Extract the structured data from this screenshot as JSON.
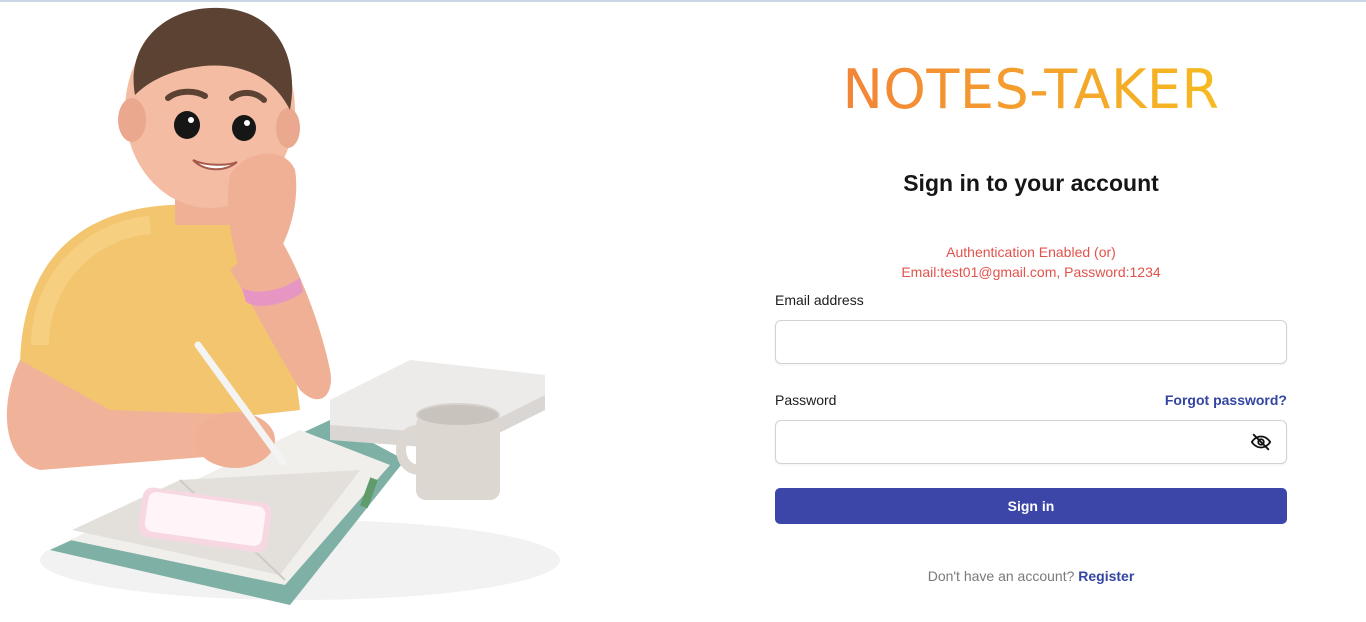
{
  "brand": {
    "title": "NOTES-TAKER",
    "gradient_start": "#f27a3b",
    "gradient_end": "#f7c41c"
  },
  "form": {
    "heading": "Sign in to your account",
    "notice_line1": "Authentication Enabled (or)",
    "notice_line2": "Email:test01@gmail.com, Password:1234",
    "email_label": "Email address",
    "email_value": "",
    "password_label": "Password",
    "password_value": "",
    "forgot_link": "Forgot password?",
    "password_toggle_icon": "eye-off-icon",
    "submit_label": "Sign in"
  },
  "footer": {
    "prompt": "Don't have an account?",
    "register_link": "Register"
  },
  "colors": {
    "primary": "#3b46a8",
    "notice": "#e2524b",
    "link": "#3345a0"
  }
}
